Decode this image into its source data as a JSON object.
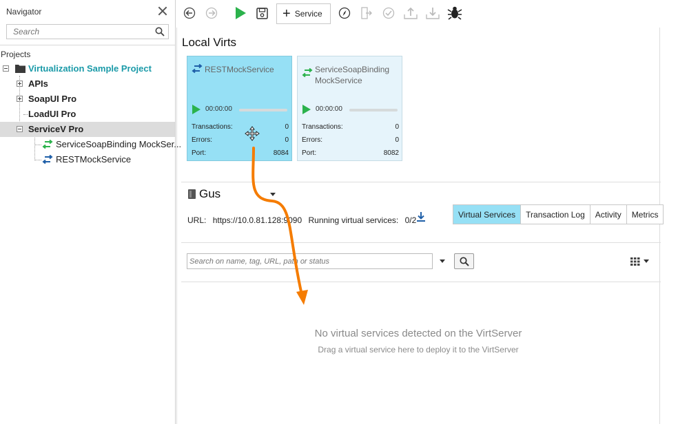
{
  "navigator": {
    "title": "Navigator",
    "search_placeholder": "Search",
    "projects_label": "Projects",
    "tree": [
      {
        "label": "Virtualization Sample Project"
      },
      {
        "label": "APIs"
      },
      {
        "label": "SoapUI Pro"
      },
      {
        "label": "LoadUI Pro"
      },
      {
        "label": "ServiceV Pro"
      },
      {
        "label": "ServiceSoapBinding MockSer..."
      },
      {
        "label": "RESTMockService"
      }
    ]
  },
  "toolbar": {
    "add_service_label": "Service"
  },
  "local_virts": {
    "title": "Local Virts",
    "cards": [
      {
        "name": "RESTMockService",
        "time": "00:00:00",
        "transactions_label": "Transactions:",
        "transactions": "0",
        "errors_label": "Errors:",
        "errors": "0",
        "port_label": "Port:",
        "port": "8084"
      },
      {
        "name": "ServiceSoapBinding MockService",
        "time": "00:00:00",
        "transactions_label": "Transactions:",
        "transactions": "0",
        "errors_label": "Errors:",
        "errors": "0",
        "port_label": "Port:",
        "port": "8082"
      }
    ]
  },
  "server": {
    "name": "Gus",
    "url_label": "URL:",
    "url": "https://10.0.81.128:9090",
    "running_label": "Running virtual services:",
    "running_value": "0/2",
    "tabs": [
      {
        "label": "Virtual Services",
        "active": true
      },
      {
        "label": "Transaction Log",
        "active": false
      },
      {
        "label": "Activity",
        "active": false
      },
      {
        "label": "Metrics",
        "active": false
      }
    ],
    "search_placeholder": "Search on name, tag, URL, path or status",
    "empty_title": "No virtual services detected on the VirtServer",
    "empty_subtitle": "Drag a virtual service here to deploy it to the VirtServer"
  },
  "colors": {
    "accent": "#96e0f5",
    "teal_text": "#1a9aa8",
    "play_green": "#2bb24c",
    "drag_arrow": "#f57c00"
  }
}
